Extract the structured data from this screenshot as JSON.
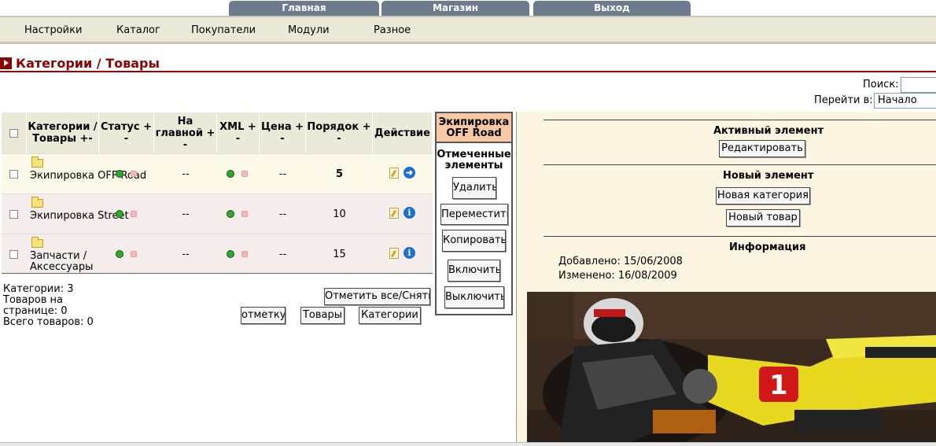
{
  "top_tabs": [
    "Главная",
    "Магазин",
    "Выход"
  ],
  "menu": [
    "Настройки",
    "Каталог",
    "Покупатели",
    "Модули",
    "Разное"
  ],
  "page_title": "Категории / Товары",
  "search": {
    "label": "Поиск:",
    "value": ""
  },
  "goto": {
    "label": "Перейти в:",
    "value": "Начало"
  },
  "table": {
    "headers": [
      "Категории / Товары +-",
      "Статус + -",
      "На главной + -",
      "XML + -",
      "Цена + -",
      "Порядок + -",
      "Действие"
    ],
    "rows": [
      {
        "name": "Экипировка OFF Road",
        "main": "--",
        "price": "--",
        "order": "5"
      },
      {
        "name": "Экипировка Street",
        "main": "--",
        "price": "--",
        "order": "10"
      },
      {
        "name": "Запчасти / Аксессуары",
        "main": "--",
        "price": "--",
        "order": "15"
      }
    ]
  },
  "summary": {
    "categories": "Категории: 3",
    "per_page_1": "Товаров на",
    "per_page_2": "странице: 0",
    "total": "Всего товаров: 0"
  },
  "bottom_buttons": {
    "mark_all": "Отметить все/Снять",
    "mark": "отметку",
    "goods": "Товары",
    "categories": "Категории"
  },
  "middle_panel": {
    "title": "Экипировка OFF Road",
    "marked": "Отмеченные элементы",
    "buttons": [
      "Удалить",
      "Переместить",
      "Копировать",
      "Включить",
      "Выключить"
    ]
  },
  "right_panel": {
    "active_title": "Активный элемент",
    "edit": "Редактировать",
    "new_title": "Новый элемент",
    "new_category": "Новая категория",
    "new_product": "Новый товар",
    "info_title": "Информация",
    "added": "Добавлено: 15/06/2008",
    "changed": "Изменено: 16/08/2009"
  },
  "colors": {
    "accent": "#8b0000",
    "tab": "#6e7b8e",
    "menu_bg": "#ebe9d8",
    "panel_bg": "#fbf5e1",
    "mid_head": "#f8c7a3"
  }
}
